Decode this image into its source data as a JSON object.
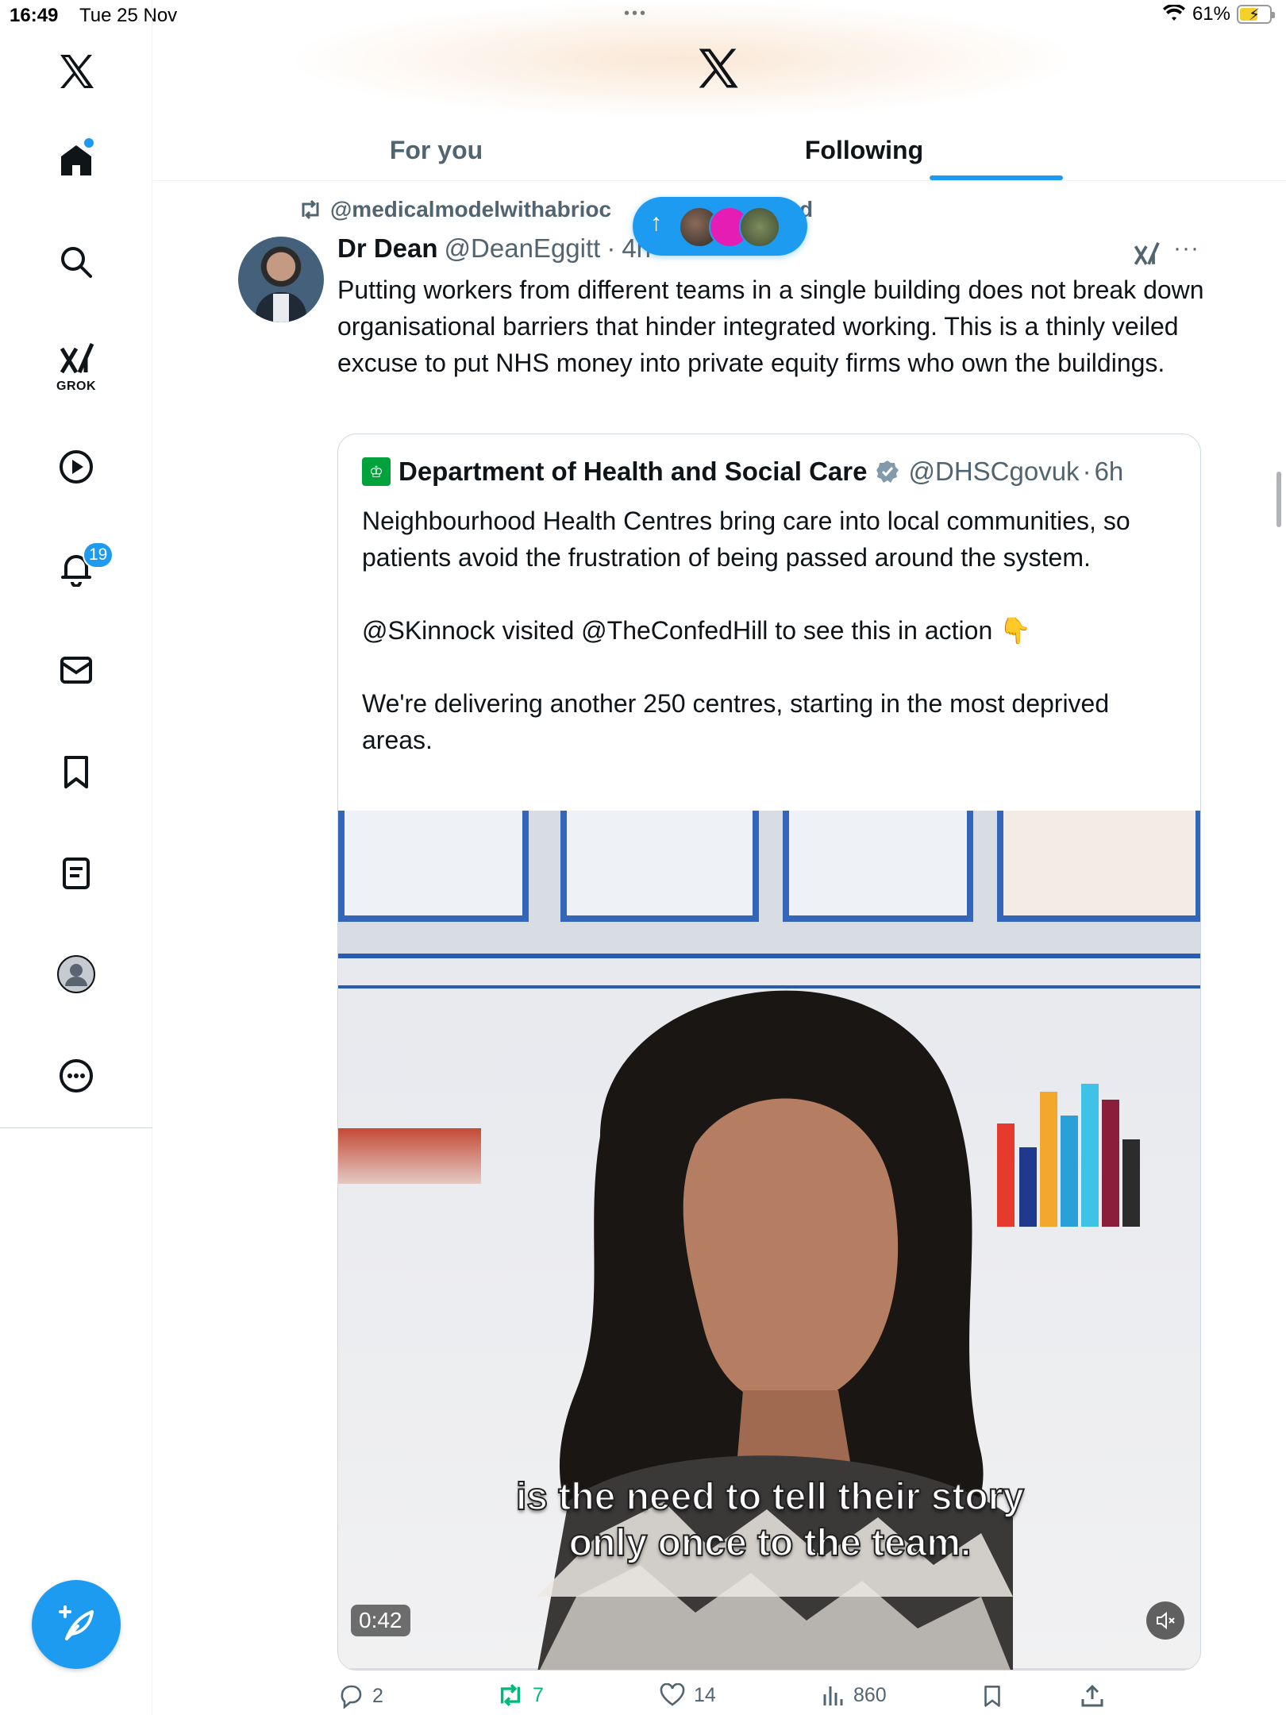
{
  "status_bar": {
    "time": "16:49",
    "date": "Tue 25 Nov",
    "battery": "61%",
    "battery_level": 0.61
  },
  "sidebar": {
    "items": [
      {
        "icon": "x-logo-icon"
      },
      {
        "icon": "home-icon",
        "has_dot": true
      },
      {
        "icon": "search-icon"
      },
      {
        "icon": "grok-icon",
        "label": "GROK"
      },
      {
        "icon": "video-play-icon"
      },
      {
        "icon": "notifications-bell-icon",
        "badge": "19"
      },
      {
        "icon": "messages-envelope-icon"
      },
      {
        "icon": "bookmarks-icon"
      },
      {
        "icon": "lists-icon"
      },
      {
        "icon": "profile-avatar-icon"
      },
      {
        "icon": "more-circle-icon"
      }
    ],
    "compose_icon": "compose-post-icon"
  },
  "header": {
    "tabs": [
      {
        "label": "For you",
        "active": false
      },
      {
        "label": "Following",
        "active": true
      }
    ],
    "accent": "#1d9bf0"
  },
  "new_posts_pill": {
    "arrow": "↑"
  },
  "tweet": {
    "repost_by": "@medicalmodelwithabrioc",
    "repost_suffix": "d",
    "author_name": "Dr Dean",
    "author_handle": "@DeanEggitt",
    "separator": "·",
    "time": "4h",
    "text": "Putting workers from different teams in a single building does not break down organisational barriers that hinder integrated working.  This is a thinly veiled excuse to put NHS money into private equity firms who own the buildings.",
    "quote": {
      "author_name": "Department of Health and Social Care",
      "author_handle": "@DHSCgovuk",
      "separator": "·",
      "time": "6h",
      "paragraphs": [
        "Neighbourhood Health Centres bring care into local communities, so patients avoid the frustration of being passed around the system.",
        "@SKinnock visited @TheConfedHill to see this in action 👇",
        "We're delivering another 250 centres, starting in the most deprived areas."
      ],
      "video": {
        "caption_line1": "is the need to tell their story",
        "caption_line2": "only once to the team.",
        "duration": "0:42"
      }
    },
    "actions": {
      "replies": "2",
      "reposts": "7",
      "likes": "14",
      "views": "860"
    }
  }
}
